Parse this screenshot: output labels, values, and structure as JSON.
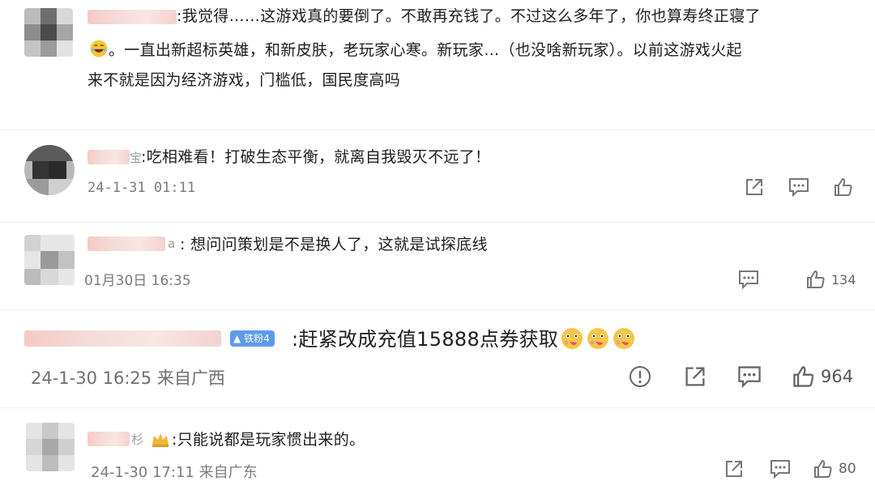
{
  "comments": [
    {
      "username_suffix": "",
      "text_line1": ":我觉得……这游戏真的要倒了。不敢再充钱了。不过这么多年了，你也算寿终正寝了",
      "text_line2": "。一直出新超标英雄，和新皮肤，老玩家心寒。新玩家…（也没啥新玩家）。以前这游戏火起",
      "text_line3": "来不就是因为经济游戏，门槛低，国民度高吗"
    },
    {
      "username_suffix": "宝",
      "text": ":吃相难看！打破生态平衡，就离自我毁灭不远了！",
      "time": "24-1-31 01:11"
    },
    {
      "username_suffix": "a",
      "text": ": 想问问策划是不是换人了，这就是试探底线",
      "time": "01月30日 16:35",
      "likes": "134"
    },
    {
      "badge": "铁粉4",
      "text": ":赶紧改成充值15888点券获取",
      "time": "24-1-30 16:25 来自广西",
      "likes": "964"
    },
    {
      "username_suffix": "杉",
      "text": ":只能说都是玩家惯出来的。",
      "time": "24-1-30 17:11 来自广东",
      "likes": "80"
    }
  ],
  "icons": {
    "share": "share-icon",
    "comment": "comment-icon",
    "like": "thumbs-up-icon",
    "report": "report-icon",
    "laugh": "laughing-emoji-icon",
    "tongue": "tongue-emoji-icon",
    "crown": "crown-icon"
  },
  "colors": {
    "badge": "#5b9bea",
    "meta_text": "#7a7a7a",
    "blurred_name": "#f3d6d2"
  }
}
